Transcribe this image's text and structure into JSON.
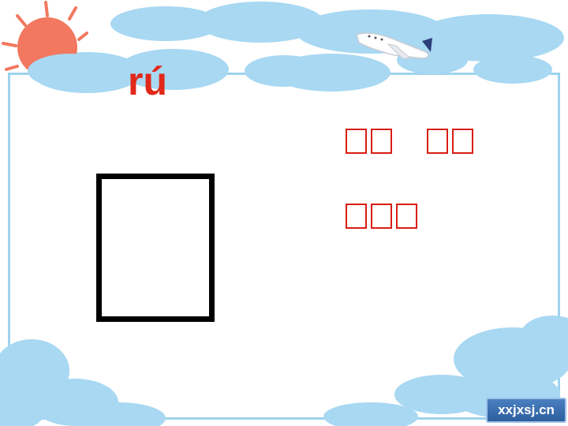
{
  "lesson": {
    "pinyin": "rú",
    "character": "",
    "words": [
      [
        "",
        ""
      ],
      [
        "",
        ""
      ],
      [
        "",
        "",
        ""
      ]
    ]
  },
  "watermark": {
    "text": "xxjxsj.cn"
  },
  "colors": {
    "pinyin": "#e1281b",
    "word_boxes": "#d81e14",
    "frame": "#9ed3ee",
    "cloud": "#a8d8f2",
    "sun": "#f2785f"
  },
  "decor": {
    "icons": [
      "sun-icon",
      "airplane-icon",
      "cloud-icon"
    ]
  }
}
